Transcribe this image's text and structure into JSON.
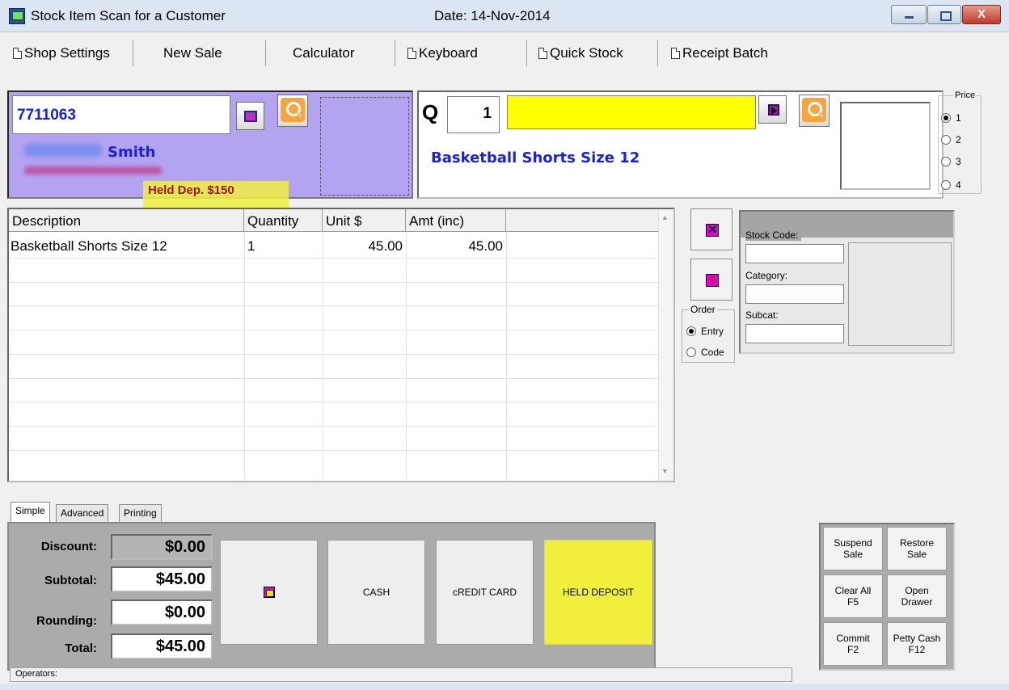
{
  "window": {
    "title": "Stock Item Scan for a Customer",
    "date": "Date: 14-Nov-2014",
    "close_glyph": "X"
  },
  "menu": {
    "shop_settings": "Shop Settings",
    "new_sale": "New Sale",
    "calculator": "Calculator",
    "keyboard": "Keyboard",
    "quick_stock": "Quick Stock",
    "receipt_batch": "Receipt Batch"
  },
  "customer": {
    "code": "7711063",
    "surname": "Smith",
    "held_deposit": "Held Dep. $150"
  },
  "scan": {
    "q_label": "Q",
    "quantity": "1",
    "item_description": "Basketball Shorts Size 12"
  },
  "price_level": {
    "title": "Price",
    "options": [
      "1",
      "2",
      "3",
      "4"
    ],
    "selected": "1"
  },
  "grid": {
    "columns": [
      "Description",
      "Quantity",
      "Unit $",
      "Amt (inc)"
    ],
    "rows": [
      {
        "description": "Basketball Shorts Size 12",
        "quantity": "1",
        "unit": "45.00",
        "amount": "45.00"
      }
    ]
  },
  "order": {
    "title": "Order",
    "options": [
      "Entry",
      "Code"
    ],
    "selected": "Entry"
  },
  "item_info": {
    "stock_code_label": "Stock Code:",
    "category_label": "Category:",
    "subcat_label": "Subcat:"
  },
  "tabs": [
    "Simple",
    "Advanced",
    "Printing"
  ],
  "totals": {
    "discount_label": "Discount:",
    "discount": "$0.00",
    "subtotal_label": "Subtotal:",
    "subtotal": "$45.00",
    "rounding_label": "Rounding:",
    "rounding": "$0.00",
    "total_label": "Total:",
    "total": "$45.00"
  },
  "payment": {
    "cash": "CASH",
    "credit_card": "cREDIT CARD",
    "held_deposit": "HELD DEPOSIT"
  },
  "actions": {
    "suspend_1": "Suspend",
    "suspend_2": "Sale",
    "restore_1": "Restore",
    "restore_2": "Sale",
    "clear_1": "Clear All",
    "clear_2": "F5",
    "open_1": "Open",
    "open_2": "Drawer",
    "commit_1": "Commit",
    "commit_2": "F2",
    "petty_1": "Petty Cash",
    "petty_2": "F12"
  },
  "status": {
    "operators": "Operators:"
  },
  "icons": [
    "app-icon",
    "document-icon",
    "customer-list-icon",
    "magnifier-icon",
    "go-to-item-icon",
    "delete-icon",
    "price-change-icon",
    "home-icon"
  ],
  "colors": {
    "customer_panel": "#b3a3f0",
    "scan_field": "#ffff00",
    "held_highlight": "#f0f03c",
    "text_blue": "#1a22d8",
    "held_text": "#a01818"
  }
}
